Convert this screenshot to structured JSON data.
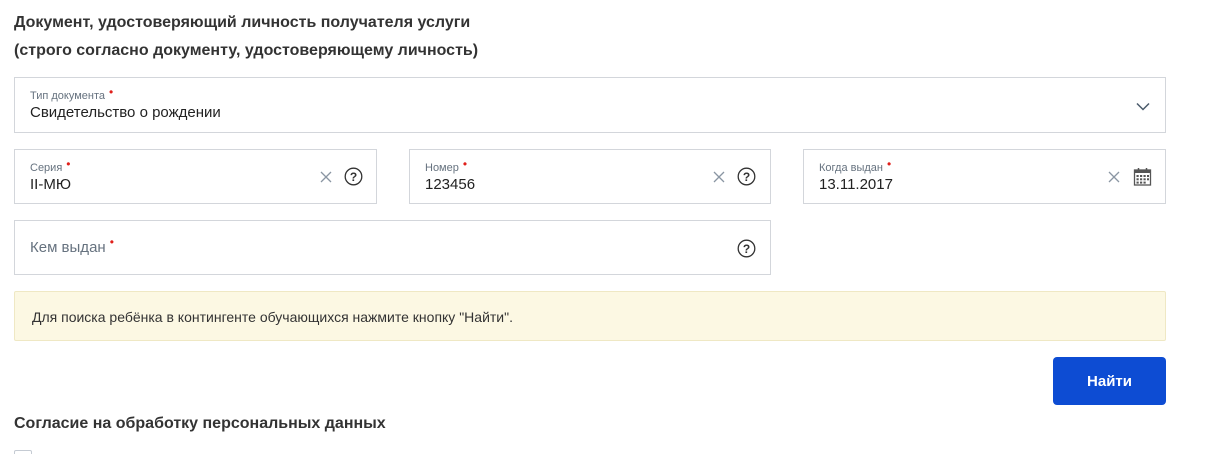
{
  "section": {
    "title_line1": "Документ, удостоверяющий личность получателя услуги",
    "title_line2": "(строго согласно документу, удостоверяющему личность)"
  },
  "doc_type": {
    "label": "Тип документа",
    "value": "Свидетельство о рождении",
    "required_mark": "•"
  },
  "series": {
    "label": "Серия",
    "value": "II-МЮ",
    "required_mark": "•"
  },
  "number": {
    "label": "Номер",
    "value": "123456",
    "required_mark": "•"
  },
  "issue_date": {
    "label": "Когда выдан",
    "value": "13.11.2017",
    "required_mark": "•"
  },
  "issued_by": {
    "placeholder": "Кем выдан",
    "required_mark": "•"
  },
  "notice": {
    "text": "Для поиска ребёнка в контингенте обучающихся нажмите кнопку \"Найти\"."
  },
  "find_button": {
    "label": "Найти"
  },
  "consent": {
    "title": "Согласие на обработку персональных данных"
  },
  "colors": {
    "primary": "#0d4cd3",
    "required": "#e0201b",
    "notice_bg": "#fcf8e3",
    "border": "#d3d6db"
  },
  "icons": {
    "dropdown": "chevron-down-icon",
    "clear": "clear-x-icon",
    "help": "help-circle-icon",
    "calendar": "calendar-icon"
  }
}
